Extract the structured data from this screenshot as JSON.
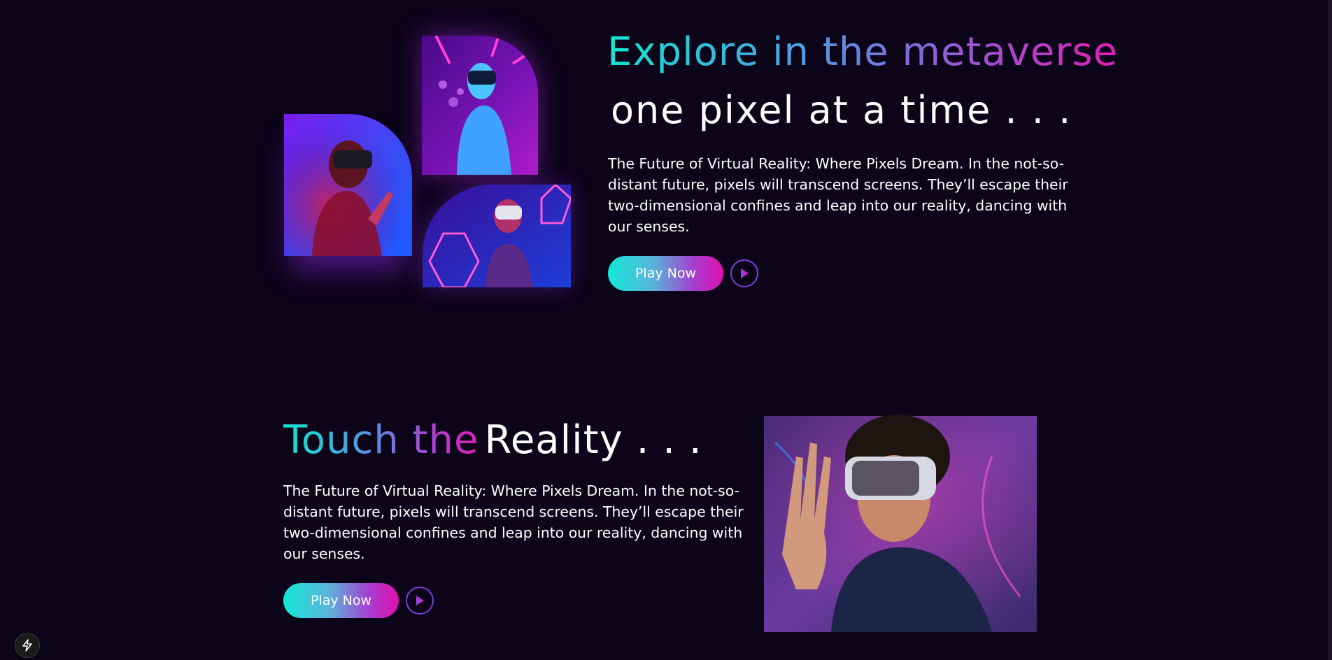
{
  "hero": {
    "title_line1": "Explore in the metaverse",
    "title_line2": "one pixel at a time . . .",
    "paragraph": "The Future of Virtual Reality: Where Pixels Dream. In the not-so-distant future, pixels will transcend screens. They’ll escape their two-dimensional confines and leap into our reality, dancing with our senses.",
    "play_label": "Play Now"
  },
  "touch": {
    "title_gradient": "Touch the",
    "title_plain": "Reality . . .",
    "paragraph": "The Future of Virtual Reality: Where Pixels Dream. In the not-so-distant future, pixels will transcend screens. They’ll escape their two-dimensional confines and leap into our reality, dancing with our senses.",
    "play_label": "Play Now"
  },
  "icons": {
    "play": "play-icon",
    "lightning": "lightning-icon"
  },
  "colors": {
    "background": "#0c0419",
    "gradient_start": "#12e6d0",
    "gradient_end": "#e01fb4",
    "circle_border": "#7a3fd6"
  }
}
